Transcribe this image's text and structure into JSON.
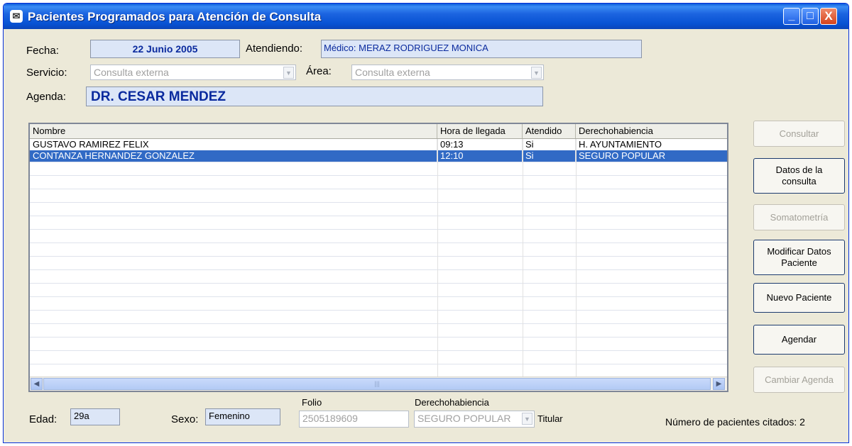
{
  "window": {
    "title": "Pacientes Programados para Atención de Consulta",
    "title_icon": "app-icon",
    "controls": {
      "minimize": "_",
      "maximize": "□",
      "close": "X"
    }
  },
  "header": {
    "fecha_label": "Fecha:",
    "fecha_value": "22 Junio 2005",
    "atendiendo_label": "Atendiendo:",
    "atendiendo_value": "Médico: MERAZ RODRIGUEZ MONICA",
    "servicio_label": "Servicio:",
    "servicio_value": "Consulta externa",
    "area_label": "Área:",
    "area_value": "Consulta externa",
    "agenda_label": "Agenda:",
    "agenda_value": "DR. CESAR MENDEZ"
  },
  "table": {
    "columns": [
      "Nombre",
      "Hora de llegada",
      "Atendido",
      "Derechohabiencia"
    ],
    "rows": [
      {
        "nombre": "GUSTAVO RAMIREZ FELIX",
        "hora": "09:13",
        "atendido": "Si",
        "derecho": "H. AYUNTAMIENTO",
        "selected": false
      },
      {
        "nombre": "CONTANZA HERNANDEZ GONZALEZ",
        "hora": "12:10",
        "atendido": "Si",
        "derecho": "SEGURO POPULAR",
        "selected": true
      }
    ]
  },
  "buttons": {
    "consultar": "Consultar",
    "datos_consulta_1": "Datos de la",
    "datos_consulta_2": "consulta",
    "somatometria": "Somatometría",
    "modificar_1": "Modificar Datos",
    "modificar_2": "Paciente",
    "nuevo_paciente": "Nuevo Paciente",
    "agendar": "Agendar",
    "cambiar_agenda": "Cambiar Agenda"
  },
  "footer": {
    "folio_label": "Folio",
    "derecho_label": "Derechohabiencia",
    "edad_label": "Edad:",
    "edad_value": "29a",
    "sexo_label": "Sexo:",
    "sexo_value": "Femenino",
    "folio_value": "2505189609",
    "derecho_value": "SEGURO POPULAR",
    "titular_label": "Titular",
    "citados_label": "Número de pacientes citados: 2"
  },
  "colors": {
    "selection": "#316ac5",
    "titlebar": "#0752d3",
    "field_bg": "#dce6f7",
    "field_text": "#0a2a9e"
  }
}
